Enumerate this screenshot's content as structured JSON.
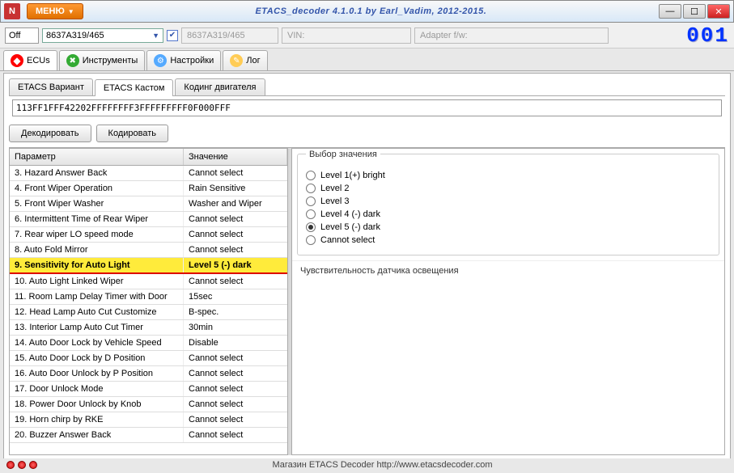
{
  "menu_label": "МЕНЮ",
  "app_title": "ETACS_decoder 4.1.0.1 by Earl_Vadim, 2012-2015.",
  "top": {
    "status": "Off",
    "combo_value": "8637A319/465",
    "grey_8637": "8637A319/465",
    "vin_label": "VIN:",
    "fw_label": "Adapter f/w:",
    "counter": "001"
  },
  "main_tabs": {
    "ecus": "ECUs",
    "tools": "Инструменты",
    "settings": "Настройки",
    "log": "Лог"
  },
  "sub_tabs": {
    "variant": "ETACS Вариант",
    "custom": "ETACS Кастом",
    "engine": "Кодинг двигателя"
  },
  "hex": "113FF1FFF42202FFFFFFFF3FFFFFFFFF0F000FFF",
  "buttons": {
    "decode": "Декодировать",
    "encode": "Кодировать"
  },
  "table": {
    "col_param": "Параметр",
    "col_value": "Значение",
    "rows": [
      {
        "p": "3. Hazard Answer Back",
        "v": "Cannot select"
      },
      {
        "p": "4. Front Wiper Operation",
        "v": "Rain Sensitive"
      },
      {
        "p": "5. Front Wiper Washer",
        "v": "Washer and Wiper"
      },
      {
        "p": "6. Intermittent Time of Rear Wiper",
        "v": "Cannot select"
      },
      {
        "p": "7. Rear wiper LO speed mode",
        "v": "Cannot select"
      },
      {
        "p": "8. Auto Fold Mirror",
        "v": "Cannot select"
      },
      {
        "p": "9. Sensitivity for Auto Light",
        "v": "Level 5 (-) dark"
      },
      {
        "p": "10. Auto Light Linked Wiper",
        "v": "Cannot select"
      },
      {
        "p": "11. Room Lamp Delay Timer with Door",
        "v": "15sec"
      },
      {
        "p": "12. Head Lamp Auto Cut Customize",
        "v": "B-spec."
      },
      {
        "p": "13. Interior Lamp Auto Cut Timer",
        "v": "30min"
      },
      {
        "p": "14. Auto Door Lock by Vehicle Speed",
        "v": "Disable"
      },
      {
        "p": "15. Auto Door Lock by D Position",
        "v": "Cannot select"
      },
      {
        "p": "16. Auto Door Unlock by P Position",
        "v": "Cannot select"
      },
      {
        "p": "17. Door Unlock Mode",
        "v": "Cannot select"
      },
      {
        "p": "18. Power Door Unlock by Knob",
        "v": "Cannot select"
      },
      {
        "p": "19. Horn chirp by RKE",
        "v": "Cannot select"
      },
      {
        "p": "20. Buzzer Answer Back",
        "v": "Cannot select"
      }
    ],
    "selected_index": 6
  },
  "right": {
    "fieldset_title": "Выбор значения",
    "options": [
      "Level 1(+) bright",
      "Level 2",
      "Level 3",
      "Level 4 (-) dark",
      "Level 5 (-) dark",
      "Cannot select"
    ],
    "selected_option": 4,
    "description": "Чувствительность датчика освещения"
  },
  "footer": "Магазин ETACS Decoder http://www.etacsdecoder.com"
}
